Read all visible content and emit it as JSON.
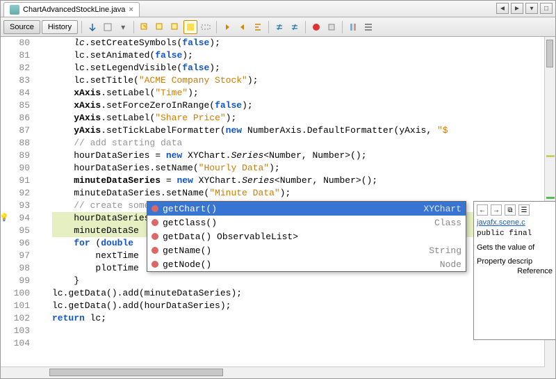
{
  "tab": {
    "title": "ChartAdvancedStockLine.java",
    "close": "×"
  },
  "toolbar": {
    "source": "Source",
    "history": "History"
  },
  "lines": [
    {
      "n": "80",
      "html": "<span class='typ'>lc</span>.setCreateSymbols(<span class='kw'>false</span>);"
    },
    {
      "n": "81",
      "html": "lc.setAnimated(<span class='kw'>false</span>);"
    },
    {
      "n": "82",
      "html": "lc.setLegendVisible(<span class='kw'>false</span>);"
    },
    {
      "n": "83",
      "html": "lc.setTitle(<span class='str'>\"ACME Company Stock\"</span>);"
    },
    {
      "n": "84",
      "html": "<span class='mth'>xAxis</span>.setLabel(<span class='str'>\"Time\"</span>);"
    },
    {
      "n": "85",
      "html": "<span class='mth'>xAxis</span>.setForceZeroInRange(<span class='kw'>false</span>);"
    },
    {
      "n": "86",
      "html": "<span class='mth'>yAxis</span>.setLabel(<span class='str'>\"Share Price\"</span>);"
    },
    {
      "n": "87",
      "html": "<span class='mth'>yAxis</span>.setTickLabelFormatter(<span class='kw'>new</span> NumberAxis.DefaultFormatter(yAxis, <span class='str'>\"$</span>"
    },
    {
      "n": "88",
      "html": "<span class='cmt'>// add starting data</span>"
    },
    {
      "n": "89",
      "html": "hourDataSeries = <span class='kw'>new</span> XYChart.<span class='typ'>Series</span>&lt;Number, Number&gt;();"
    },
    {
      "n": "90",
      "html": "hourDataSeries.setName(<span class='str'>\"Hourly Data\"</span>);"
    },
    {
      "n": "91",
      "html": "<span class='mth'>minuteDataSeries</span> = <span class='kw'>new</span> XYChart.<span class='typ'>Series</span>&lt;Number, Number&gt;();"
    },
    {
      "n": "92",
      "html": "minuteDataSeries.setName(<span class='str'>\"Minute Data\"</span>);"
    },
    {
      "n": "93",
      "html": "<span class='cmt'>// create some starting data</span>"
    },
    {
      "n": "94",
      "hl": true,
      "bulb": true,
      "html": "hourDataSeries.get<span class='cursor'></span>Data().add(<span class='kw'>new</span> XYChart.Data&lt;Number, Number&gt;(timeInH"
    },
    {
      "n": "95",
      "hl": true,
      "html": "minuteDataSe"
    },
    {
      "n": "96",
      "html": "<span class='kw'>for</span> (<span class='kw'>double</span>"
    },
    {
      "n": "97",
      "html": "    nextTime"
    },
    {
      "n": "98",
      "html": "    plotTime"
    },
    {
      "n": "99",
      "html": "}"
    },
    {
      "n": "100",
      "html": "lc.getData().add(minuteDataSeries);",
      "unindent": true
    },
    {
      "n": "101",
      "html": "lc.getData().add(hourDataSeries);",
      "unindent": true
    },
    {
      "n": "102",
      "html": "<span class='kw'>return</span> lc;",
      "unindent": true
    },
    {
      "n": "103",
      "html": ""
    },
    {
      "n": "104",
      "html": ""
    }
  ],
  "completion": {
    "items": [
      {
        "label": "getChart()",
        "rtype": "XYChart<Number, Number>",
        "sel": true
      },
      {
        "label": "getClass()",
        "rtype": "Class<?>"
      },
      {
        "label": "getData() ObservableList<Data<Number, Number>>",
        "rtype": ""
      },
      {
        "label": "getName()",
        "rtype": "String"
      },
      {
        "label": "getNode()",
        "rtype": "Node"
      }
    ]
  },
  "doc": {
    "pkg": "javafx.scene.c",
    "sig": "public final",
    "desc1": "Gets the value of",
    "desc2": "Property descrip",
    "ref": "Reference"
  }
}
